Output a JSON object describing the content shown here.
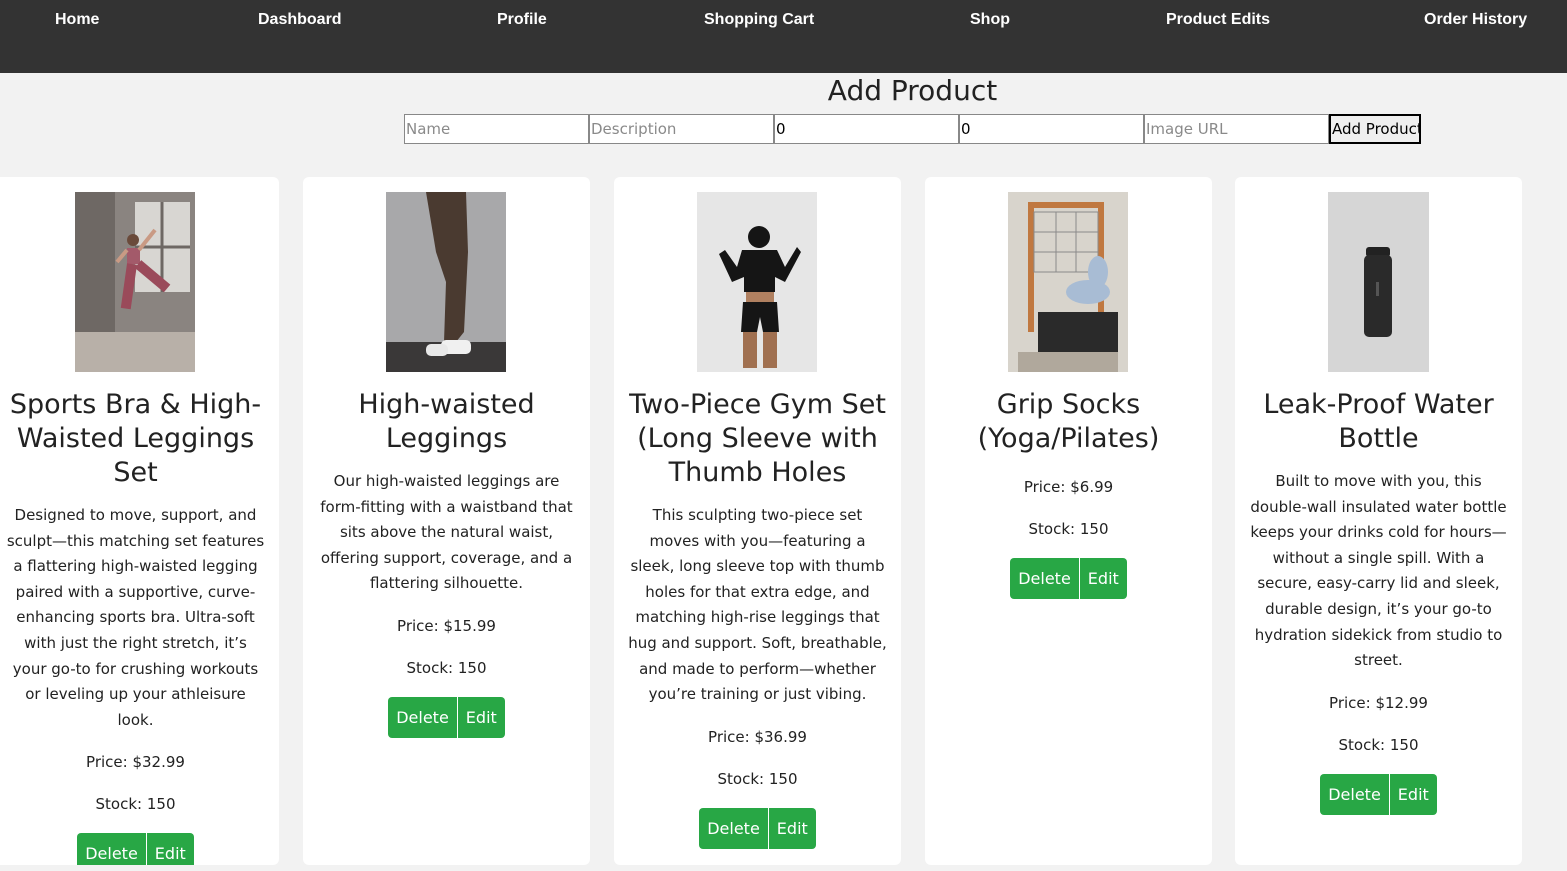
{
  "nav": {
    "items": [
      {
        "label": "Home"
      },
      {
        "label": "Dashboard"
      },
      {
        "label": "Profile"
      },
      {
        "label": "Shopping Cart"
      },
      {
        "label": "Shop"
      },
      {
        "label": "Product Edits"
      },
      {
        "label": "Order History"
      }
    ]
  },
  "add_form": {
    "title": "Add Product",
    "name_placeholder": "Name",
    "description_placeholder": "Description",
    "price_value": "0",
    "stock_value": "0",
    "image_placeholder": "Image URL",
    "submit_label": "Add Product"
  },
  "products": [
    {
      "title": "Sports Bra & High-Waisted Leggings Set",
      "description": "Designed to move, support, and sculpt—this matching set features a flattering high-waisted legging paired with a supportive, curve-enhancing sports bra. Ultra-soft with just the right stretch, it’s your go-to for crushing workouts or leveling up your athleisure look.",
      "price": "Price: $32.99",
      "stock": "Stock: 150",
      "delete_label": "Delete",
      "edit_label": "Edit"
    },
    {
      "title": "High-waisted Leggings",
      "description": "Our high-waisted leggings are form-fitting with a waistband that sits above the natural waist, offering support, coverage, and a flattering silhouette.",
      "price": "Price: $15.99",
      "stock": "Stock: 150",
      "delete_label": "Delete",
      "edit_label": "Edit"
    },
    {
      "title": "Two-Piece Gym Set (Long Sleeve with Thumb Holes",
      "description": "This sculpting two-piece set moves with you—featuring a sleek, long sleeve top with thumb holes for that extra edge, and matching high-rise leggings that hug and support. Soft, breathable, and made to perform—whether you’re training or just vibing.",
      "price": "Price: $36.99",
      "stock": "Stock: 150",
      "delete_label": "Delete",
      "edit_label": "Edit"
    },
    {
      "title": "Grip Socks (Yoga/Pilates)",
      "description": "",
      "price": "Price: $6.99",
      "stock": "Stock: 150",
      "delete_label": "Delete",
      "edit_label": "Edit"
    },
    {
      "title": "Leak-Proof Water Bottle",
      "description": "Built to move with you, this double-wall insulated water bottle keeps your drinks cold for hours—without a single spill. With a secure, easy-carry lid and sleek, durable design, it’s your go-to hydration sidekick from studio to street.",
      "price": "Price: $12.99",
      "stock": "Stock: 150",
      "delete_label": "Delete",
      "edit_label": "Edit"
    }
  ],
  "colors": {
    "navbar": "#333333",
    "page_bg": "#f2f2f2",
    "button_green": "#28a745"
  }
}
